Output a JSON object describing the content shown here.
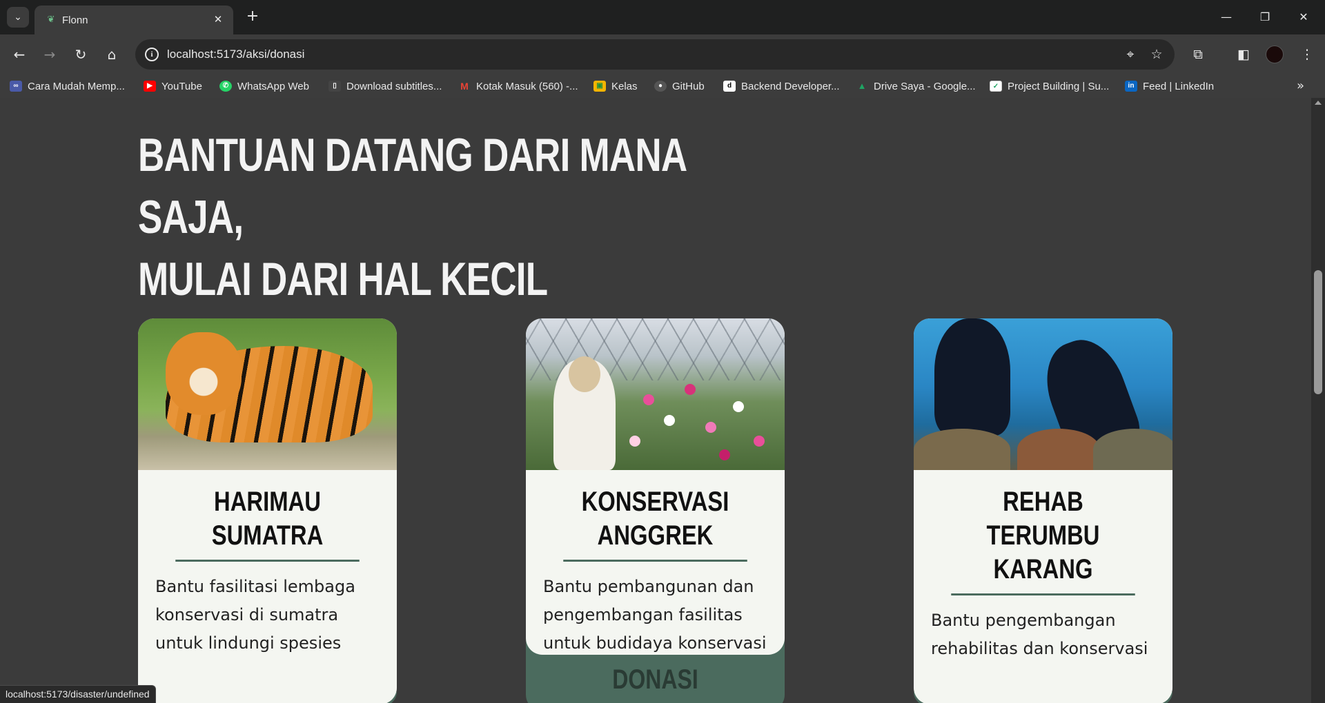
{
  "browser": {
    "tab_title": "Flonn",
    "new_tab_symbol": "+",
    "url": "localhost:5173/aksi/donasi",
    "status_url": "localhost:5173/disaster/undefined"
  },
  "bookmarks": [
    {
      "label": "Cara Mudah Memp...",
      "icon": "link-icon",
      "color": "#6b8cff"
    },
    {
      "label": "YouTube",
      "icon": "youtube-icon",
      "color": "#ff0000"
    },
    {
      "label": "WhatsApp Web",
      "icon": "whatsapp-icon",
      "color": "#25d366"
    },
    {
      "label": "Download subtitles...",
      "icon": "page-icon",
      "color": "#555555"
    },
    {
      "label": "Kotak Masuk (560) -...",
      "icon": "gmail-icon",
      "color": "#ea4335"
    },
    {
      "label": "Kelas",
      "icon": "classroom-icon",
      "color": "#f4b400"
    },
    {
      "label": "GitHub",
      "icon": "github-icon",
      "color": "#444444"
    },
    {
      "label": "Backend Developer...",
      "icon": "dicoding-icon",
      "color": "#ffffff"
    },
    {
      "label": "Drive Saya - Google...",
      "icon": "drive-icon",
      "color": "#1fa463"
    },
    {
      "label": "Project Building | Su...",
      "icon": "project-icon",
      "color": "#ffffff"
    },
    {
      "label": "Feed | LinkedIn",
      "icon": "linkedin-icon",
      "color": "#0a66c2"
    }
  ],
  "page": {
    "heading_line1": "BANTUAN DATANG DARI MANA SAJA,",
    "heading_line2": "MULAI DARI HAL KECIL",
    "cards": [
      {
        "title": "HARIMAU SUMATRA",
        "description": "Bantu fasilitasi lembaga konservasi di sumatra untuk lindungi spesies",
        "image": "tiger-photo"
      },
      {
        "title": "KONSERVASI ANGGREK",
        "description": "Bantu pembangunan dan pengembangan fasilitas untuk budidaya konservasi",
        "image": "orchid-photo"
      },
      {
        "title": "REHAB TERUMBU KARANG",
        "description": "Bantu pengembangan rehabilitas dan konservasi",
        "image": "coral-reef-photo"
      }
    ],
    "donate_label": "DONASI"
  },
  "colors": {
    "page_bg": "#3b3b3b",
    "card_bg": "#f4f6f1",
    "accent_green": "#4b6b5e",
    "heading_text": "#f3f3f3"
  }
}
